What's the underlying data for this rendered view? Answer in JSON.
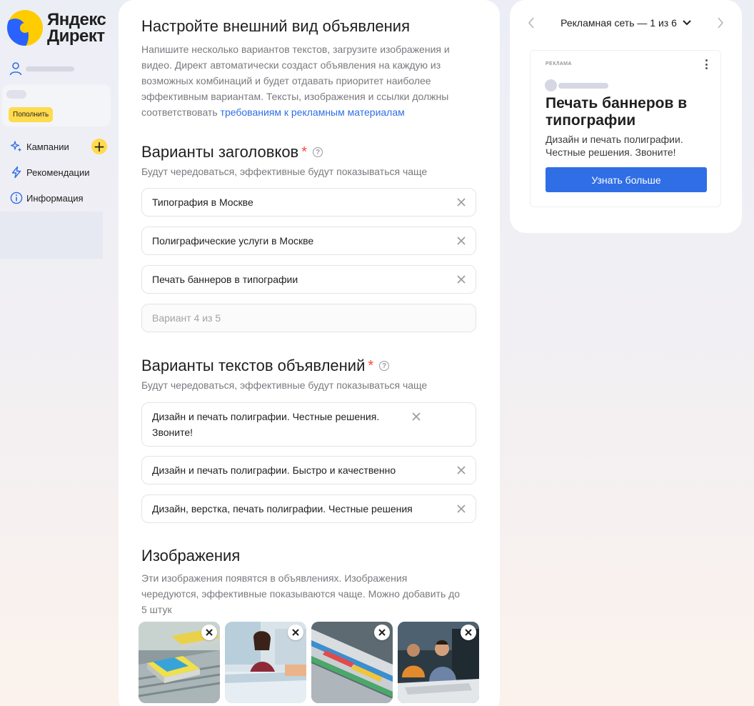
{
  "brand": {
    "line1": "Яндекс",
    "line2": "Директ",
    "accent_color": "#ffcc00",
    "brand_blue": "#2962ff"
  },
  "sidebar": {
    "topup_label": "Пополнить",
    "items": [
      {
        "label": "Кампании",
        "icon": "sparkle-icon"
      },
      {
        "label": "Рекомендации",
        "icon": "lightning-icon"
      },
      {
        "label": "Информация",
        "icon": "info-icon"
      }
    ]
  },
  "main": {
    "title": "Настройте внешний вид объявления",
    "intro_text": "Напишите несколько вариантов текстов, загрузите изображения и видео. Директ автоматически создаст объявления на каждую из возможных комбинаций и будет отдавать приоритет наиболее эффективным вариантам. Тексты, изображения и ссылки должны соответствовать ",
    "intro_link": "требованиям к рекламным материалам",
    "headlines": {
      "title": "Варианты заголовков",
      "required_mark": "*",
      "help_icon": "?",
      "subtitle": "Будут чередоваться, эффективные будут показываться чаще",
      "items": [
        "Типография в Москве",
        "Полиграфические услуги в Москве",
        "Печать баннеров в типографии"
      ],
      "placeholder": "Вариант 4 из 5"
    },
    "texts": {
      "title": "Варианты текстов объявлений",
      "required_mark": "*",
      "help_icon": "?",
      "subtitle": "Будут чередоваться, эффективные будут показываться чаще",
      "items": [
        "Дизайн и печать полиграфии. Честные решения. Звоните!",
        "Дизайн и печать полиграфии. Быстро и качественно",
        "Дизайн, верстка, печать полиграфии. Честные решения"
      ]
    },
    "images": {
      "title": "Изображения",
      "subtitle": "Эти изображения появятся в объявлениях. Изображения чередуются, эффективные показываются чаще. Можно добавить до 5 штук",
      "count_shown": 4
    }
  },
  "preview": {
    "network_label": "Рекламная сеть — 1 из 6",
    "ad": {
      "label": "РЕКЛАМА",
      "title": "Печать баннеров в типографии",
      "text": "Дизайн и печать полиграфии. Честные решения. Звоните!",
      "button": "Узнать больше",
      "button_color": "#2f6ee5"
    }
  }
}
